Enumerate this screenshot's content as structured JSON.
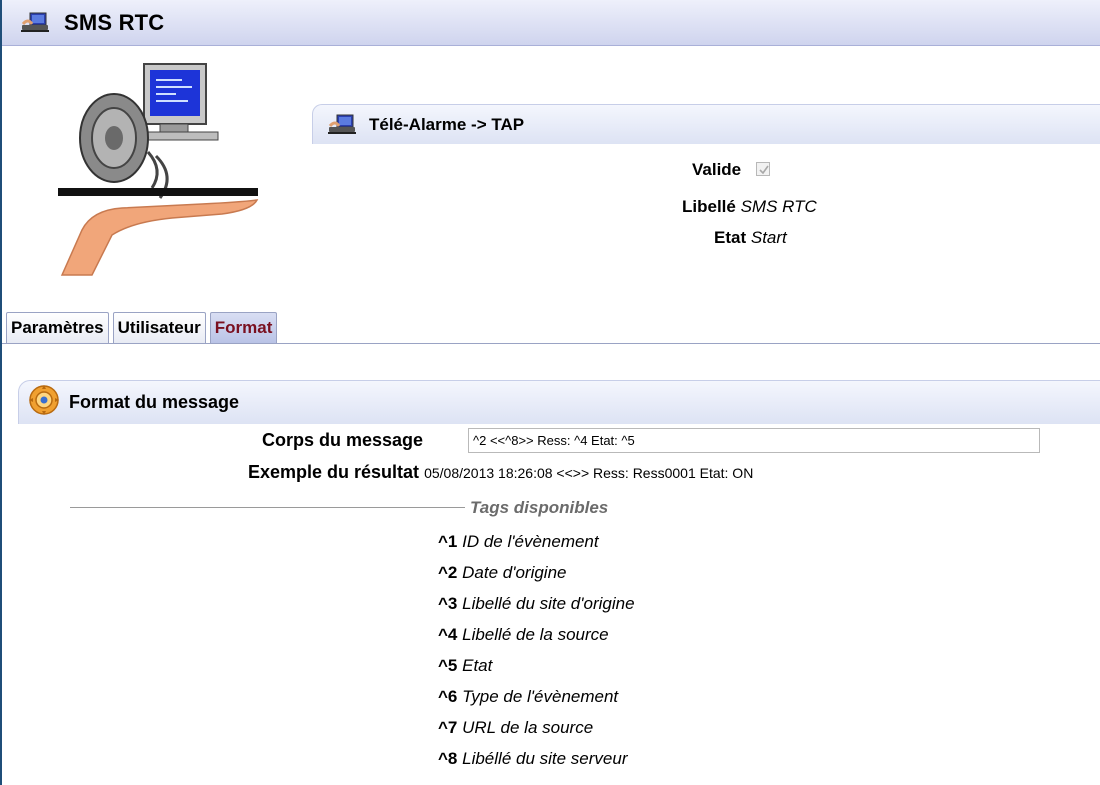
{
  "window": {
    "title": "SMS RTC",
    "icon": "phone-monitor-icon"
  },
  "section": {
    "title": "Télé-Alarme -> TAP",
    "fields": {
      "valide_label": "Valide",
      "valide_checked": true,
      "libelle_label": "Libellé",
      "libelle_value": "SMS RTC",
      "etat_label": "Etat",
      "etat_value": "Start"
    }
  },
  "tabs": [
    {
      "label": "Paramètres",
      "active": false
    },
    {
      "label": "Utilisateur",
      "active": false
    },
    {
      "label": "Format",
      "active": true
    }
  ],
  "format": {
    "title": "Format du message",
    "icon": "gear-icon",
    "corps_label": "Corps du message",
    "corps_value": "^2 <<^8>> Ress: ^4 Etat: ^5",
    "exemple_label": "Exemple du résultat",
    "exemple_value": "05/08/2013 18:26:08 <<>> Ress: Ress0001 Etat: ON",
    "tags_title": "Tags disponibles",
    "tags": [
      {
        "code": "^1",
        "desc": "ID de l'évènement"
      },
      {
        "code": "^2",
        "desc": "Date d'origine"
      },
      {
        "code": "^3",
        "desc": "Libellé du site d'origine"
      },
      {
        "code": "^4",
        "desc": "Libellé de la source"
      },
      {
        "code": "^5",
        "desc": "Etat"
      },
      {
        "code": "^6",
        "desc": "Type de l'évènement"
      },
      {
        "code": "^7",
        "desc": "URL de la source"
      },
      {
        "code": "^8",
        "desc": "Libéllé du site serveur"
      }
    ]
  },
  "colors": {
    "active_tab_text": "#7a1020",
    "header_bg": "#dde3f4"
  }
}
